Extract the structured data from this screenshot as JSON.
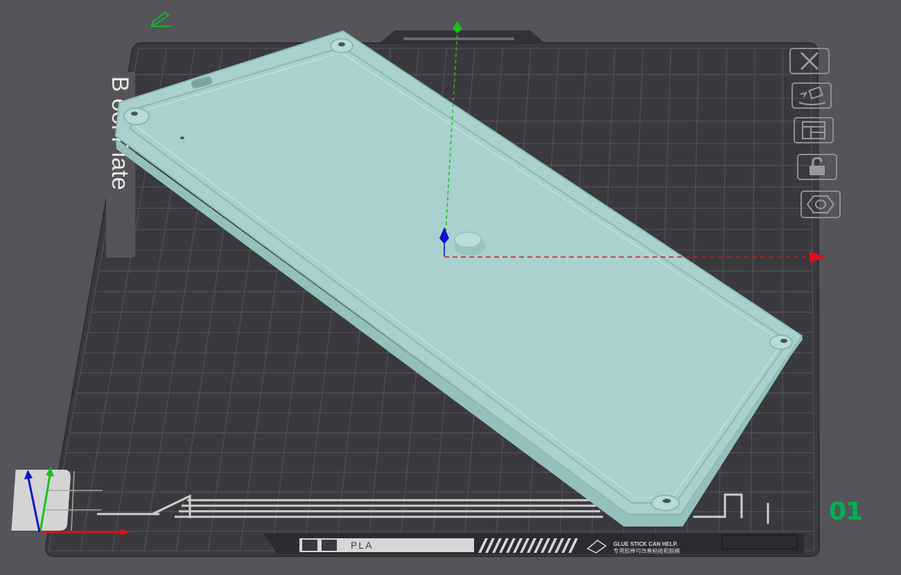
{
  "plate": {
    "name": "Bambu Textured PEI Plate",
    "side_label_visible": "B   ool Plate",
    "number": "01",
    "filament_label": "PLA",
    "hint_line1": "GLUE STICK CAN HELP.",
    "hint_line2": "专用胶棒可改善粘接和脱模"
  },
  "toolbar": {
    "buttons": [
      {
        "name": "remove-plate-button",
        "icon": "close-icon"
      },
      {
        "name": "auto-orient-button",
        "icon": "auto-orient-icon"
      },
      {
        "name": "arrange-button",
        "icon": "arrange-icon"
      },
      {
        "name": "lock-plate-button",
        "icon": "lock-icon"
      },
      {
        "name": "plate-settings-button",
        "icon": "hexagon-nut-icon"
      }
    ]
  },
  "model": {
    "name": "enclosure-tray",
    "color": "#a9d1cf"
  },
  "colors": {
    "background": "#545459",
    "bed": "#3a3a3e",
    "grid": "#5c5c61",
    "axis_x": "#e0101a",
    "axis_y": "#17c21c",
    "axis_z": "#1010c8",
    "plate_number": "#00b050"
  }
}
